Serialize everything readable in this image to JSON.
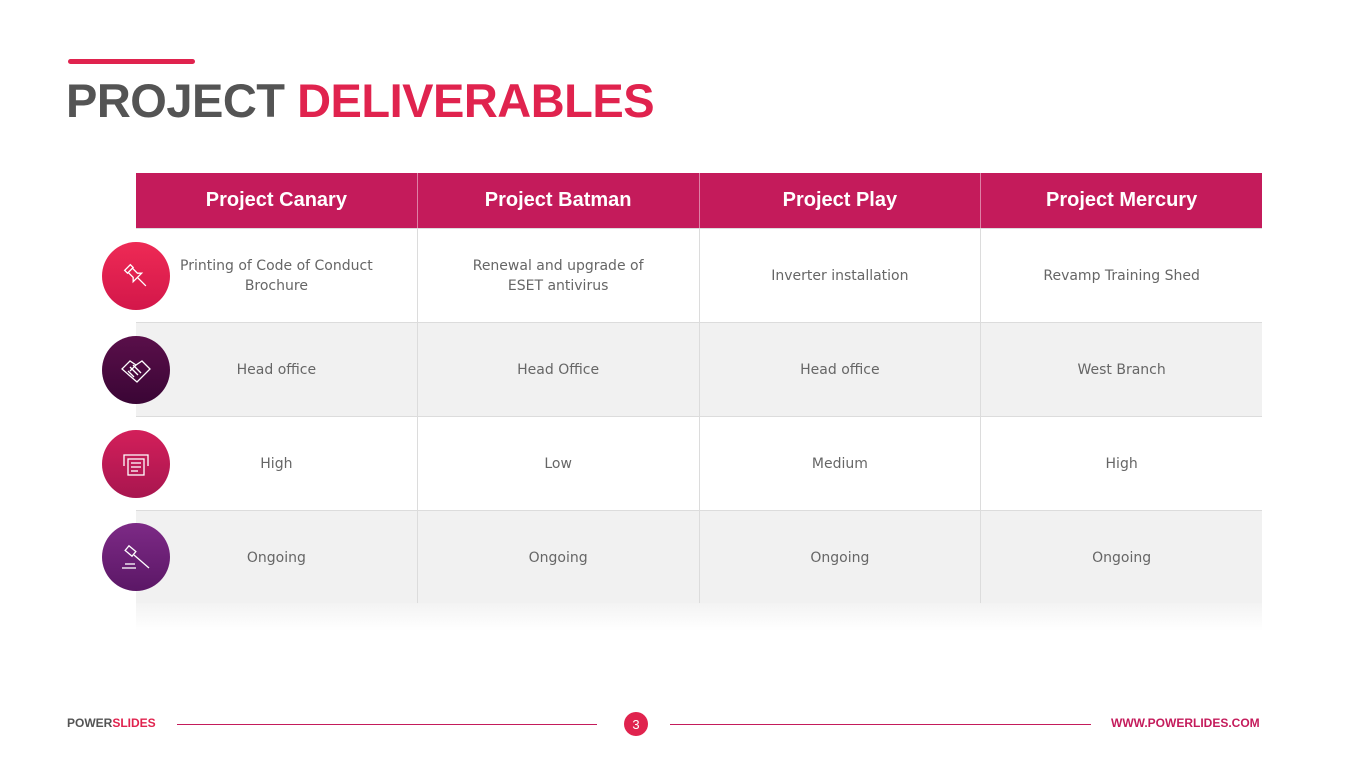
{
  "title": {
    "part1": "PROJECT",
    "part2": "DELIVERABLES"
  },
  "table": {
    "headers": [
      "Project Canary",
      "Project Batman",
      "Project Play",
      "Project Mercury"
    ],
    "rows": [
      {
        "icon": "pushpin-icon",
        "cells": [
          "Printing of Code of Conduct Brochure",
          "Renewal and upgrade of ESET antivirus",
          "Inverter installation",
          "Revamp Training Shed"
        ]
      },
      {
        "icon": "handshake-icon",
        "cells": [
          "Head office",
          "Head Office",
          "Head office",
          "West Branch"
        ]
      },
      {
        "icon": "printer-document-icon",
        "cells": [
          "High",
          "Low",
          "Medium",
          "High"
        ]
      },
      {
        "icon": "gavel-icon",
        "cells": [
          "Ongoing",
          "Ongoing",
          "Ongoing",
          "Ongoing"
        ]
      }
    ]
  },
  "footer": {
    "brand_part1": "POWER",
    "brand_part2": "SLIDES",
    "page_number": "3",
    "url": "WWW.POWERLIDES.COM"
  },
  "colors": {
    "accent": "#e0234e",
    "header": "#c41b5b",
    "title_gray": "#545454"
  }
}
